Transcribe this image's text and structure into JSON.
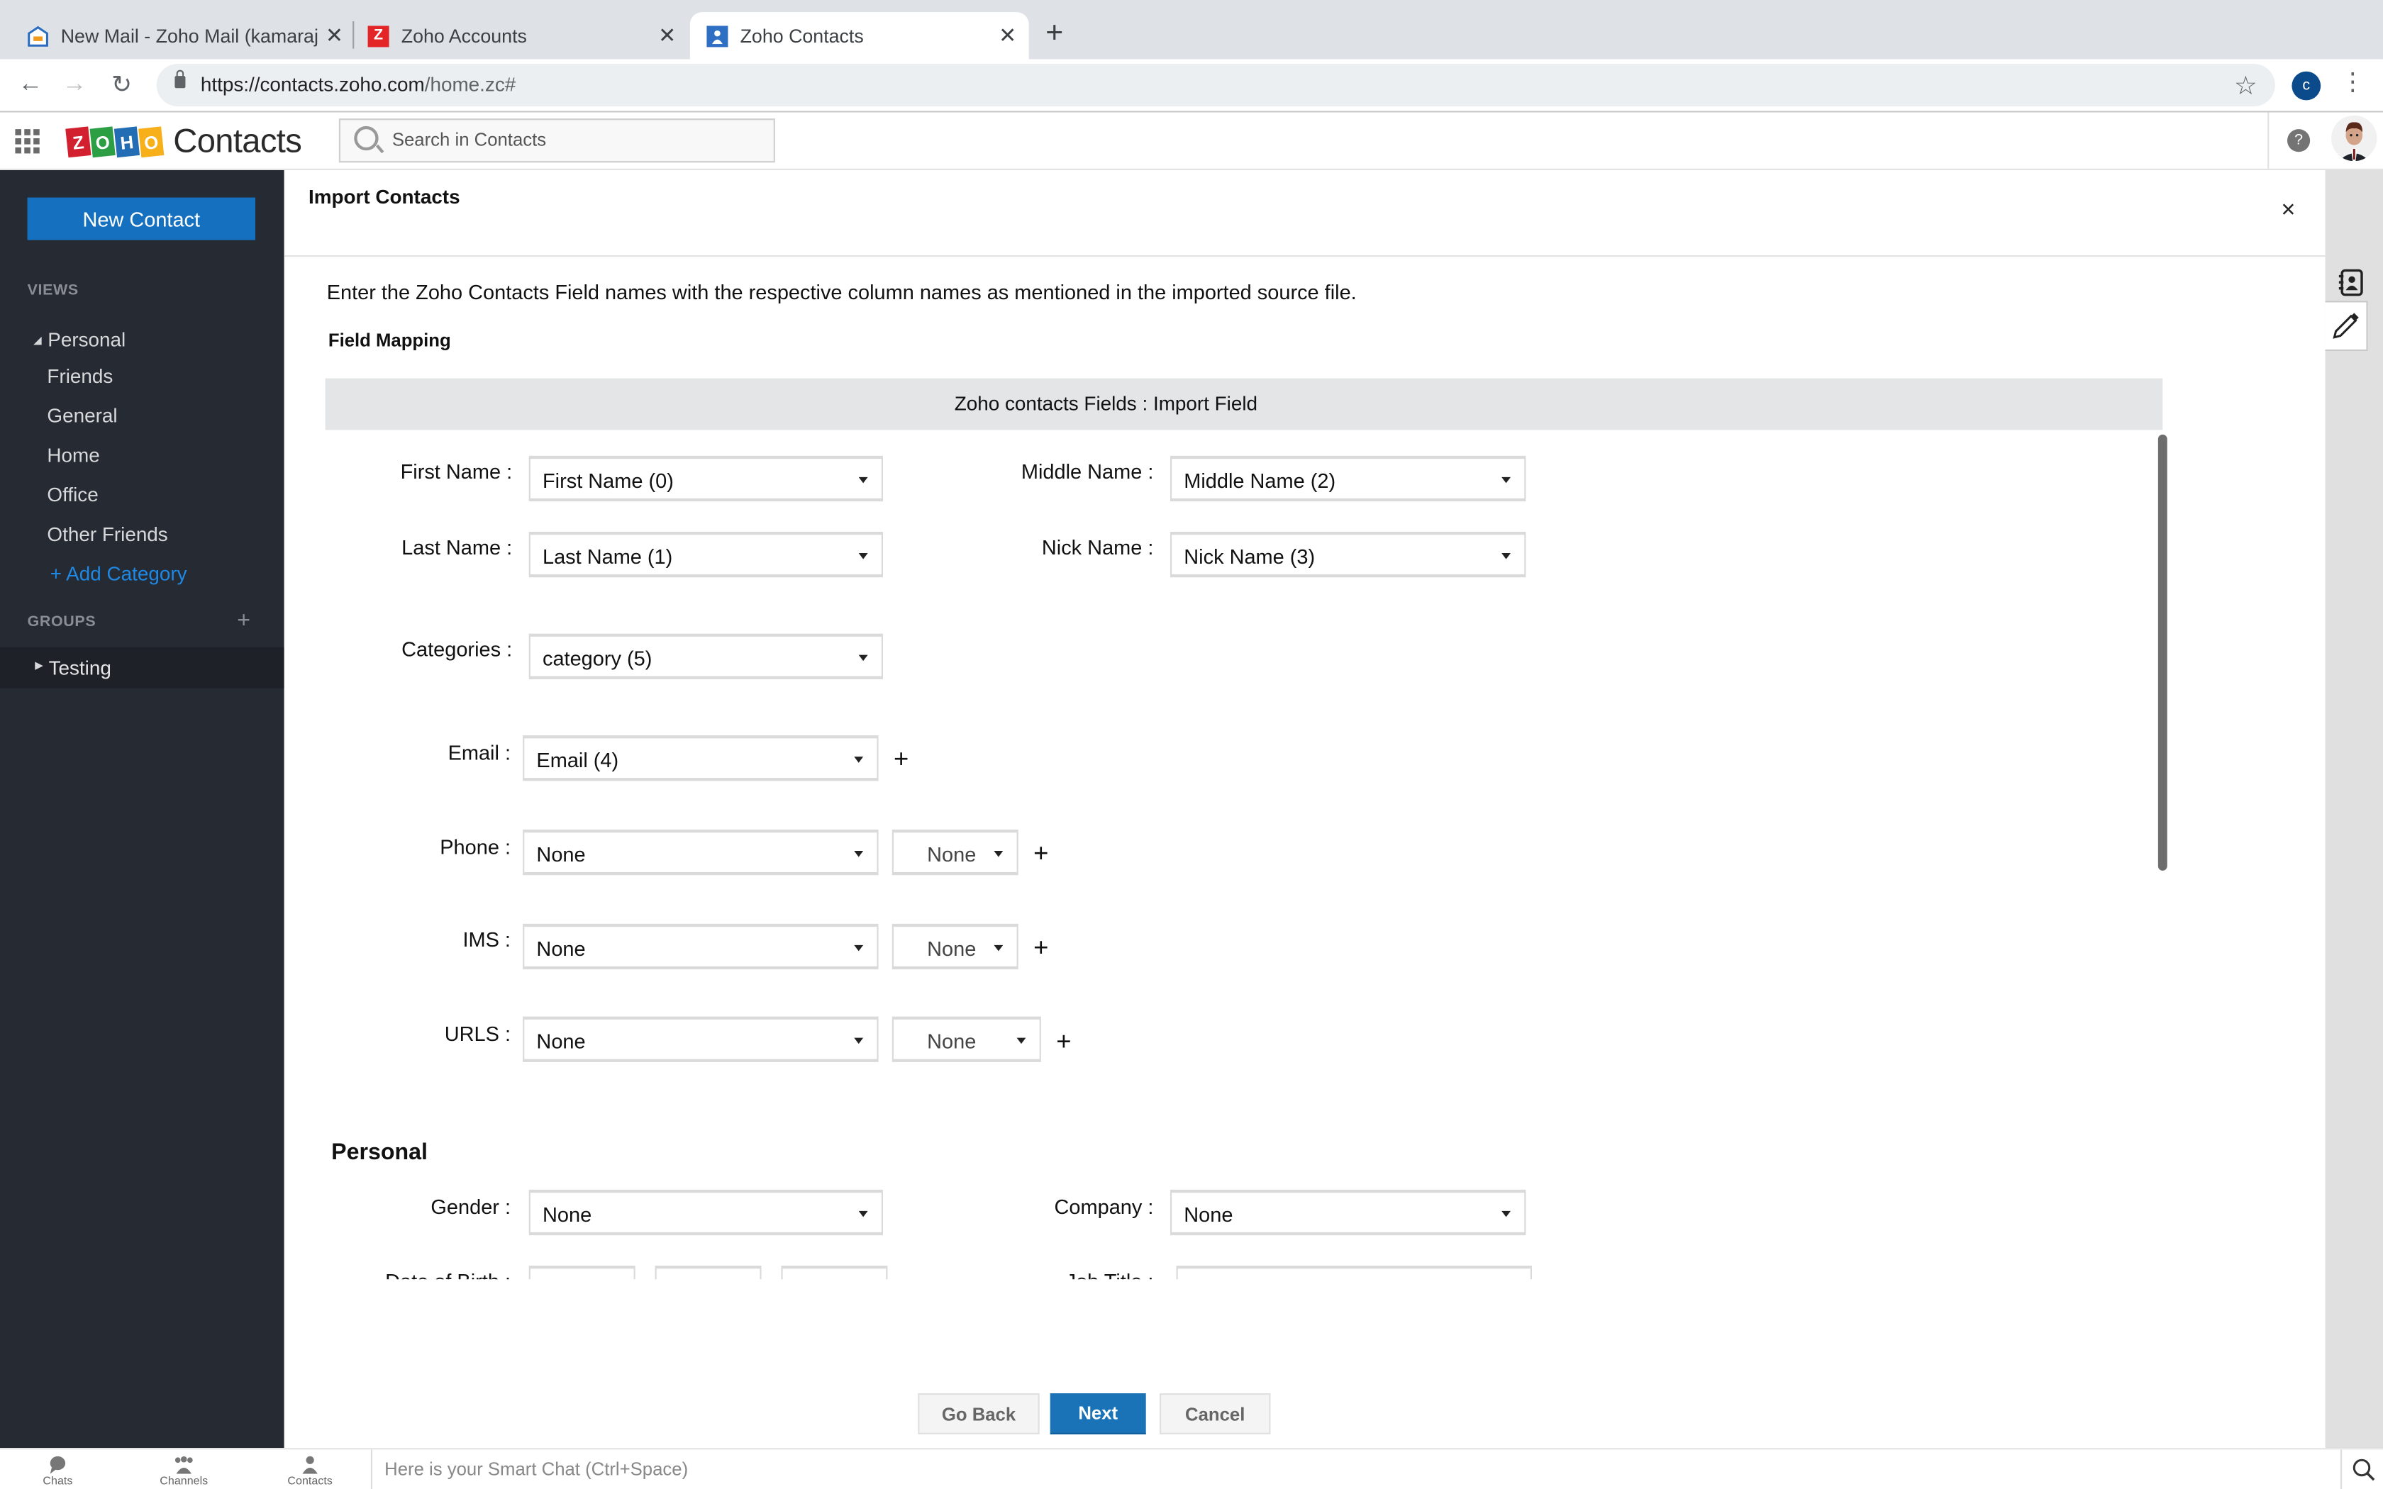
{
  "browser": {
    "tabs": [
      {
        "title": "New Mail - Zoho Mail (kamaraj",
        "favicon": "zoho-mail-icon",
        "active": false
      },
      {
        "title": "Zoho Accounts",
        "favicon": "zoho-accounts-icon",
        "favicon_glyph": "Z",
        "active": false
      },
      {
        "title": "Zoho Contacts",
        "favicon": "zoho-contacts-icon",
        "active": true
      }
    ],
    "close_glyph": "✕",
    "new_tab_glyph": "+",
    "url_main": "https://contacts.zoho.com",
    "url_path": "/home.zc#",
    "profile_initial": "c",
    "back_glyph": "←",
    "forward_glyph": "→",
    "reload_glyph": "↻",
    "star_glyph": "☆",
    "menu_glyph": "⋮"
  },
  "app": {
    "logo_letters": [
      "Z",
      "O",
      "H",
      "O"
    ],
    "logo_colors": [
      "#d2202f",
      "#2c9f45",
      "#226db4",
      "#f7b019"
    ],
    "product_name": "Contacts",
    "search_placeholder": "Search in Contacts",
    "help_glyph": "?"
  },
  "sidebar": {
    "new_contact_label": "New Contact",
    "views_heading": "VIEWS",
    "personal_label": "Personal",
    "categories": [
      "Friends",
      "General",
      "Home",
      "Office",
      "Other Friends"
    ],
    "add_category_label": "+ Add Category",
    "groups_heading": "GROUPS",
    "groups_add_glyph": "+",
    "groups": [
      "Testing"
    ]
  },
  "modal": {
    "title": "Import Contacts",
    "close_glyph": "×",
    "intro": "Enter the Zoho Contacts Field names with the respective column names as mentioned in the imported source file.",
    "field_mapping_label": "Field Mapping",
    "mapping_header": "Zoho contacts Fields :  Import Field",
    "fields": {
      "first_name": {
        "label": "First Name :",
        "value": "First Name (0)"
      },
      "middle_name": {
        "label": "Middle Name :",
        "value": "Middle Name (2)"
      },
      "last_name": {
        "label": "Last Name :",
        "value": "Last Name (1)"
      },
      "nick_name": {
        "label": "Nick Name :",
        "value": "Nick Name (3)"
      },
      "categories": {
        "label": "Categories :",
        "value": "category (5)"
      },
      "email": {
        "label": "Email :",
        "value": "Email (4)"
      },
      "phone": {
        "label": "Phone :",
        "value": "None",
        "type_value": "None"
      },
      "ims": {
        "label": "IMS :",
        "value": "None",
        "type_value": "None"
      },
      "urls": {
        "label": "URLS :",
        "value": "None",
        "type_value": "None"
      }
    },
    "add_glyph": "+",
    "personal_heading": "Personal",
    "personal_fields": {
      "gender": {
        "label": "Gender :",
        "value": "None"
      },
      "company": {
        "label": "Company :",
        "value": "None"
      },
      "dob": {
        "label": "Date of Birth :"
      },
      "job_title": {
        "label": "Job Title :"
      }
    },
    "buttons": {
      "back": "Go Back",
      "next": "Next",
      "cancel": "Cancel"
    }
  },
  "bottombar": {
    "items": [
      "Chats",
      "Channels",
      "Contacts"
    ],
    "smart_chat_placeholder": "Here is your Smart Chat (Ctrl+Space)"
  },
  "colors": {
    "accent": "#1571c0",
    "sidebar_bg": "#262a33",
    "link": "#1e88e5"
  }
}
